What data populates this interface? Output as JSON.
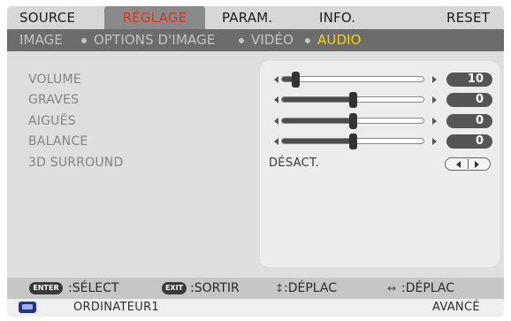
{
  "tabs": [
    {
      "label": "SOURCE",
      "active": false
    },
    {
      "label": "RÉGLAGE",
      "active": true
    },
    {
      "label": "PARAM.",
      "active": false
    },
    {
      "label": "INFO.",
      "active": false
    },
    {
      "label": "RESET",
      "active": false
    }
  ],
  "subtabs": [
    {
      "label": "IMAGE",
      "active": false
    },
    {
      "label": "OPTIONS D'IMAGE",
      "active": false
    },
    {
      "label": "VIDÉO",
      "active": false
    },
    {
      "label": "AUDIO",
      "active": true
    }
  ],
  "settings": [
    {
      "label": "VOLUME",
      "value": "10",
      "level_pct": 10
    },
    {
      "label": "GRAVES",
      "value": "0",
      "level_pct": 50
    },
    {
      "label": "AIGUËS",
      "value": "0",
      "level_pct": 50
    },
    {
      "label": "BALANCE",
      "value": "0",
      "level_pct": 50
    },
    {
      "label": "3D SURROUND",
      "value": "DÉSACT."
    }
  ],
  "help": [
    {
      "key": "ENTER",
      "text": ":SÉLECT"
    },
    {
      "key": "EXIT",
      "text": ":SORTIR"
    },
    {
      "key": "↕",
      "text": ":DÉPLAC"
    },
    {
      "key": "↔",
      "text": ":DÉPLAC"
    }
  ],
  "status": {
    "source": "ORDINATEUR1",
    "mode": "AVANCÉ"
  },
  "colors": {
    "active_tab_text": "#e2321a",
    "active_subtab_text": "#f2d21a",
    "source_icon": "#25348a"
  }
}
